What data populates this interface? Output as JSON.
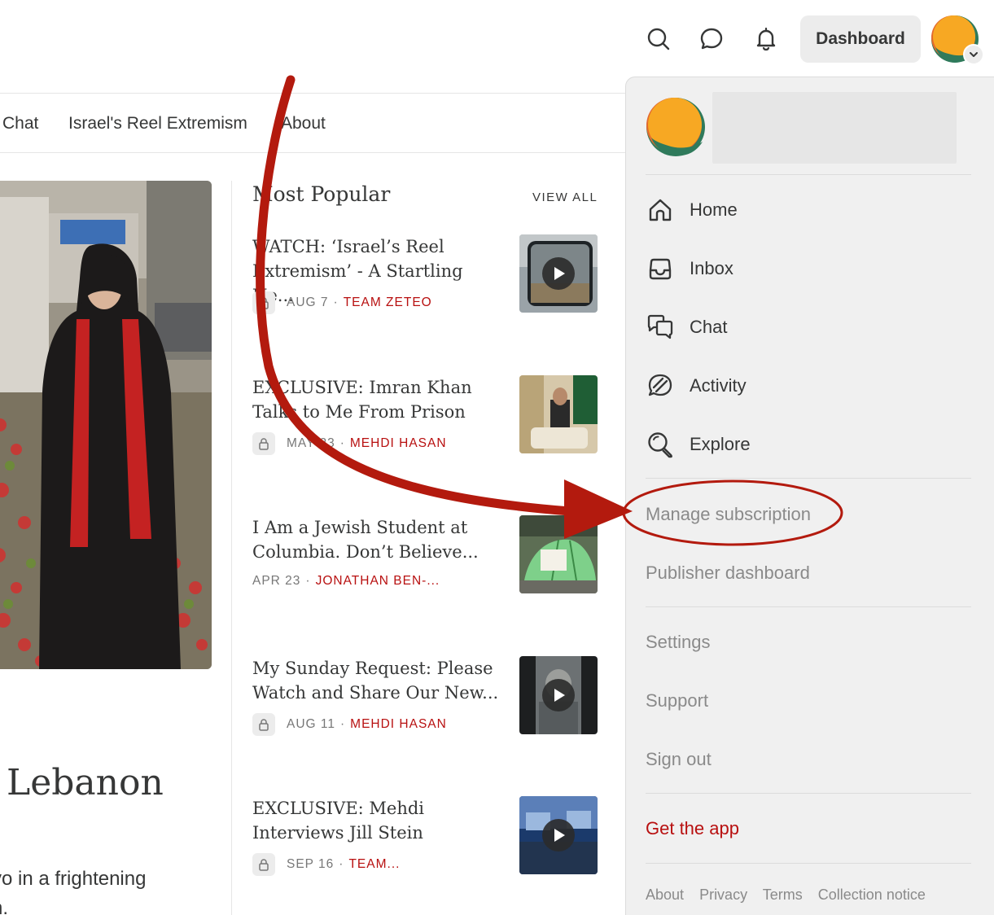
{
  "topbar": {
    "dashboard_label": "Dashboard"
  },
  "nav": {
    "items": [
      "Chat",
      "Israel's Reel Extremism",
      "About"
    ]
  },
  "article": {
    "title": ". Lebanon",
    "subtitle_line1": "vo in a frightening",
    "subtitle_line2": "n."
  },
  "most_popular": {
    "title": "Most Popular",
    "view_all": "VIEW ALL",
    "posts": [
      {
        "title": "WATCH: ‘Israel’s Reel Extremism’ - A Startling Ne...",
        "date": "AUG 7",
        "author": "TEAM ZETEO",
        "locked": true
      },
      {
        "title": "EXCLUSIVE: Imran Khan Talks to Me From Prison",
        "date": "MAY 23",
        "author": "MEHDI HASAN",
        "locked": true
      },
      {
        "title": "I Am a Jewish Student at Columbia. Don’t Believe...",
        "date": "APR 23",
        "author": "JONATHAN BEN-...",
        "locked": false
      },
      {
        "title": "My Sunday Request: Please Watch and Share Our New...",
        "date": "AUG 11",
        "author": "MEHDI HASAN",
        "locked": true
      },
      {
        "title": "EXCLUSIVE: Mehdi Interviews Jill Stein",
        "date": "SEP 16",
        "author": "TEAM...",
        "locked": true
      }
    ],
    "separator": "·"
  },
  "menu": {
    "nav_items": [
      {
        "label": "Home",
        "icon": "home-icon"
      },
      {
        "label": "Inbox",
        "icon": "inbox-icon"
      },
      {
        "label": "Chat",
        "icon": "chat-icon"
      },
      {
        "label": "Activity",
        "icon": "activity-icon"
      },
      {
        "label": "Explore",
        "icon": "explore-icon"
      }
    ],
    "manage_subscription": "Manage subscription",
    "publisher_dashboard": "Publisher dashboard",
    "settings": "Settings",
    "support": "Support",
    "sign_out": "Sign out",
    "get_app": "Get the app",
    "footer": [
      "About",
      "Privacy",
      "Terms",
      "Collection notice"
    ]
  },
  "colors": {
    "accent_red": "#b81010",
    "annotation_red": "#b31a0e",
    "menu_bg": "#f0f0f0",
    "text": "#363737",
    "muted": "#8a8a8a"
  }
}
